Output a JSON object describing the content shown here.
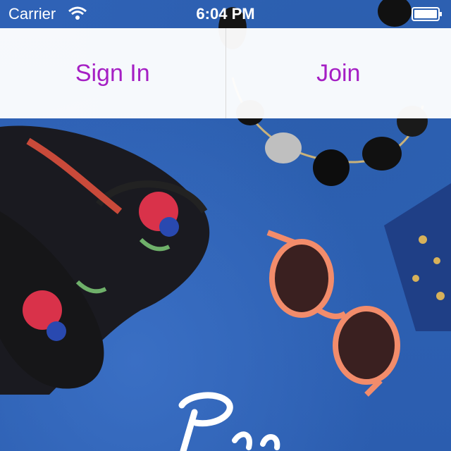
{
  "status_bar": {
    "carrier": "Carrier",
    "time": "6:04 PM",
    "icons": [
      "wifi-icon",
      "battery-icon"
    ]
  },
  "auth": {
    "sign_in_label": "Sign In",
    "join_label": "Join"
  },
  "colors": {
    "accent": "#a51fc4",
    "background": "#2f63b7",
    "bar": "#ffffff"
  },
  "logo_name": "poshmark-logo"
}
